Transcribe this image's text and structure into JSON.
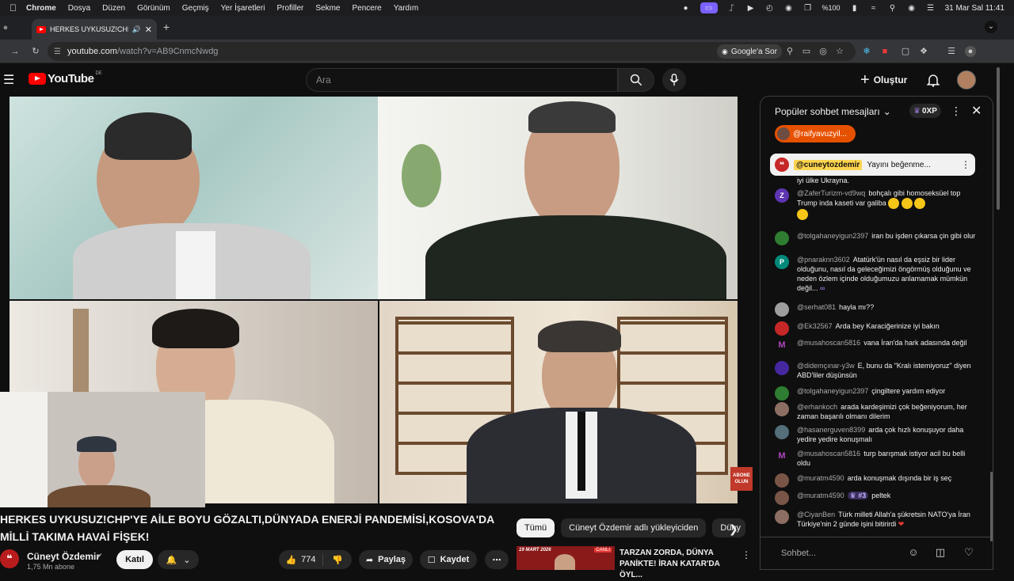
{
  "menubar": {
    "app": "Chrome",
    "items": [
      "Dosya",
      "Düzen",
      "Görünüm",
      "Geçmiş",
      "Yer İşaretleri",
      "Profiller",
      "Sekme",
      "Pencere",
      "Yardım"
    ],
    "battery": "%100",
    "datetime": "31 Mar Sal  11:41"
  },
  "browser": {
    "tab_title": "HERKES UYKUSUZ!CHP'Y",
    "url_host": "youtube.com",
    "url_path": "/watch?v=AB9CnmcNwdg",
    "ask_google": "Google'a Sor"
  },
  "youtube": {
    "logo_text": "YouTube",
    "country": "DE",
    "search_placeholder": "Ara",
    "create_label": "Oluştur"
  },
  "video": {
    "title": "HERKES UYKUSUZ!CHP'YE AİLE BOYU GÖZALTI,DÜNYADA ENERJİ PANDEMİSİ,KOSOVA'DA MİLLİ TAKIMA HAVAİ FİŞEK!",
    "badge": "ABONE OLUN"
  },
  "channel": {
    "name": "Cüneyt Özdemir",
    "subs": "1,75 Mn abone",
    "join": "Katıl",
    "likes": "774",
    "share": "Paylaş",
    "save": "Kaydet"
  },
  "chips": {
    "all": "Tümü",
    "uploader": "Cüneyt Özdemir adlı yükleyiciden",
    "more": "Düny"
  },
  "related": {
    "title": "TARZAN ZORDA, DÜNYA PANİKTE! İRAN KATAR'DA ÖYL...",
    "thumb_date": "19 MART 2026",
    "thumb_tag": "CANLI"
  },
  "chat": {
    "title": "Popüler sohbet mesajları",
    "xp": "0XP",
    "super_chip": "@raifyavuzyil...",
    "pinned_author": "@cuneytozdemir",
    "pinned_text": "Yayını beğenme...",
    "input_placeholder": "Sohbet...",
    "messages": [
      {
        "author": "",
        "text": "iyi ülke Ukrayna.",
        "avatar": "",
        "color": "#888"
      },
      {
        "author": "@ZaferTurizm-vd9wq",
        "text": "bohçalı gibi homoseksüel top Trump inda kaseti var galiba",
        "avatar": "Z",
        "color": "#5e35b1"
      },
      {
        "author": "@tolgahaneyigun2397",
        "text": "iran bu işden çıkarsa çin gibi olur",
        "avatar": "",
        "color": "#2e7d32"
      },
      {
        "author": "@pnaraknn3602",
        "text": "Atatürk'ün nasıl da eşsiz bir lider olduğunu, nasıl da geleceğimizi öngörmüş olduğunu ve neden özlem içinde olduğumuzu anlamamak mümkün değil...",
        "avatar": "P",
        "color": "#00897b"
      },
      {
        "author": "@serhat081",
        "text": "hayla mı??",
        "avatar": "",
        "color": "#9e9e9e"
      },
      {
        "author": "@Ek32567",
        "text": "Arda bey Karaciğerinize iyi bakın",
        "avatar": "",
        "color": "#c62828"
      },
      {
        "author": "@musahoscan5816",
        "text": "vana İran'da hark adasında değil",
        "avatar": "M",
        "color": "#6a1b9a"
      },
      {
        "author": "@didemçınar-y3w",
        "text": "E, bunu da \"Kralı istemiyoruz\" diyen ABD'liler düşünsün",
        "avatar": "",
        "color": "#4527a0"
      },
      {
        "author": "@tolgahaneyigun2397",
        "text": "çingiltere yardım ediyor",
        "avatar": "",
        "color": "#2e7d32"
      },
      {
        "author": "@erhankoch",
        "text": "arada kardeşimizi çok beğeniyorum, her zaman başarılı olmanı dilerim",
        "avatar": "",
        "color": "#8d6e63"
      },
      {
        "author": "@hasanerguven8399",
        "text": "arda çok hızlı konuşuyor daha yedire yedire konuşmalı",
        "avatar": "",
        "color": "#546e7a"
      },
      {
        "author": "@musahoscan5816",
        "text": "turp barışmak istiyor acil bu belli oldu",
        "avatar": "M",
        "color": "#6a1b9a"
      },
      {
        "author": "@muratm4590",
        "text": "arda konuşmak dışında bir iş seç",
        "avatar": "",
        "color": "#795548"
      },
      {
        "author": "@muratm4590",
        "text": "peltek",
        "avatar": "",
        "color": "#795548",
        "badge": "#3"
      },
      {
        "author": "@CiyanBen",
        "text": "Türk milleti Allah'a şükretsin NATO'ya İran Türkiye'nin 2 günde işini bitirirdi",
        "avatar": "",
        "color": "#8d6e63"
      }
    ]
  }
}
